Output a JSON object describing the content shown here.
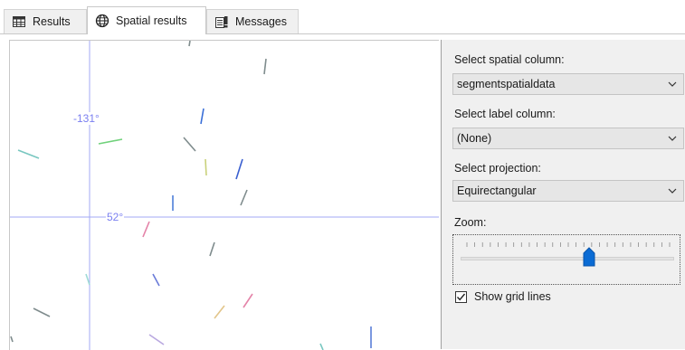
{
  "tabs": [
    {
      "label": "Results",
      "icon": "grid-table-icon",
      "active": false
    },
    {
      "label": "Spatial results",
      "icon": "globe-icon",
      "active": true
    },
    {
      "label": "Messages",
      "icon": "messages-icon",
      "active": false
    }
  ],
  "map": {
    "grid_lon_label": "-131°",
    "grid_lat_label": "52°",
    "grid_color": "#9aa0f5"
  },
  "panel": {
    "spatial_column_label": "Select spatial column:",
    "spatial_column_value": "segmentspatialdata",
    "label_column_label": "Select label column:",
    "label_column_value": "(None)",
    "projection_label": "Select projection:",
    "projection_value": "Equirectangular",
    "zoom_label": "Zoom:",
    "zoom_fraction": 0.6,
    "show_grid_label": "Show grid lines",
    "show_grid_checked": true
  },
  "colors": {
    "accent": "#0a6bd4",
    "panel_bg": "#f0f0f0"
  }
}
